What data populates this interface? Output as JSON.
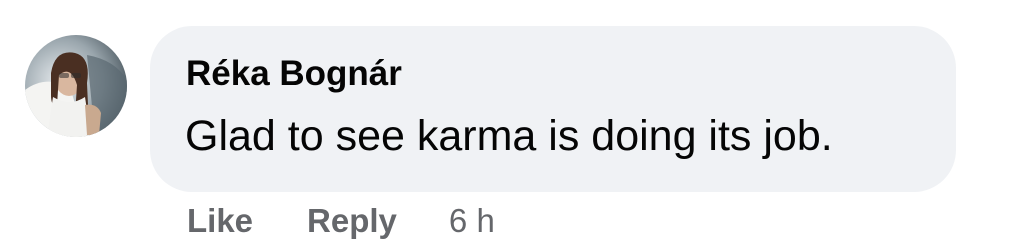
{
  "comment": {
    "author": "Réka Bognár",
    "text": "Glad to see karma is doing its job.",
    "actions": {
      "like_label": "Like",
      "reply_label": "Reply"
    },
    "timestamp": "6 h"
  },
  "avatar": {
    "icon": "user-profile-photo"
  },
  "colors": {
    "bubble_background": "#f0f2f5",
    "primary_text": "#050505",
    "secondary_text": "#65676b"
  }
}
